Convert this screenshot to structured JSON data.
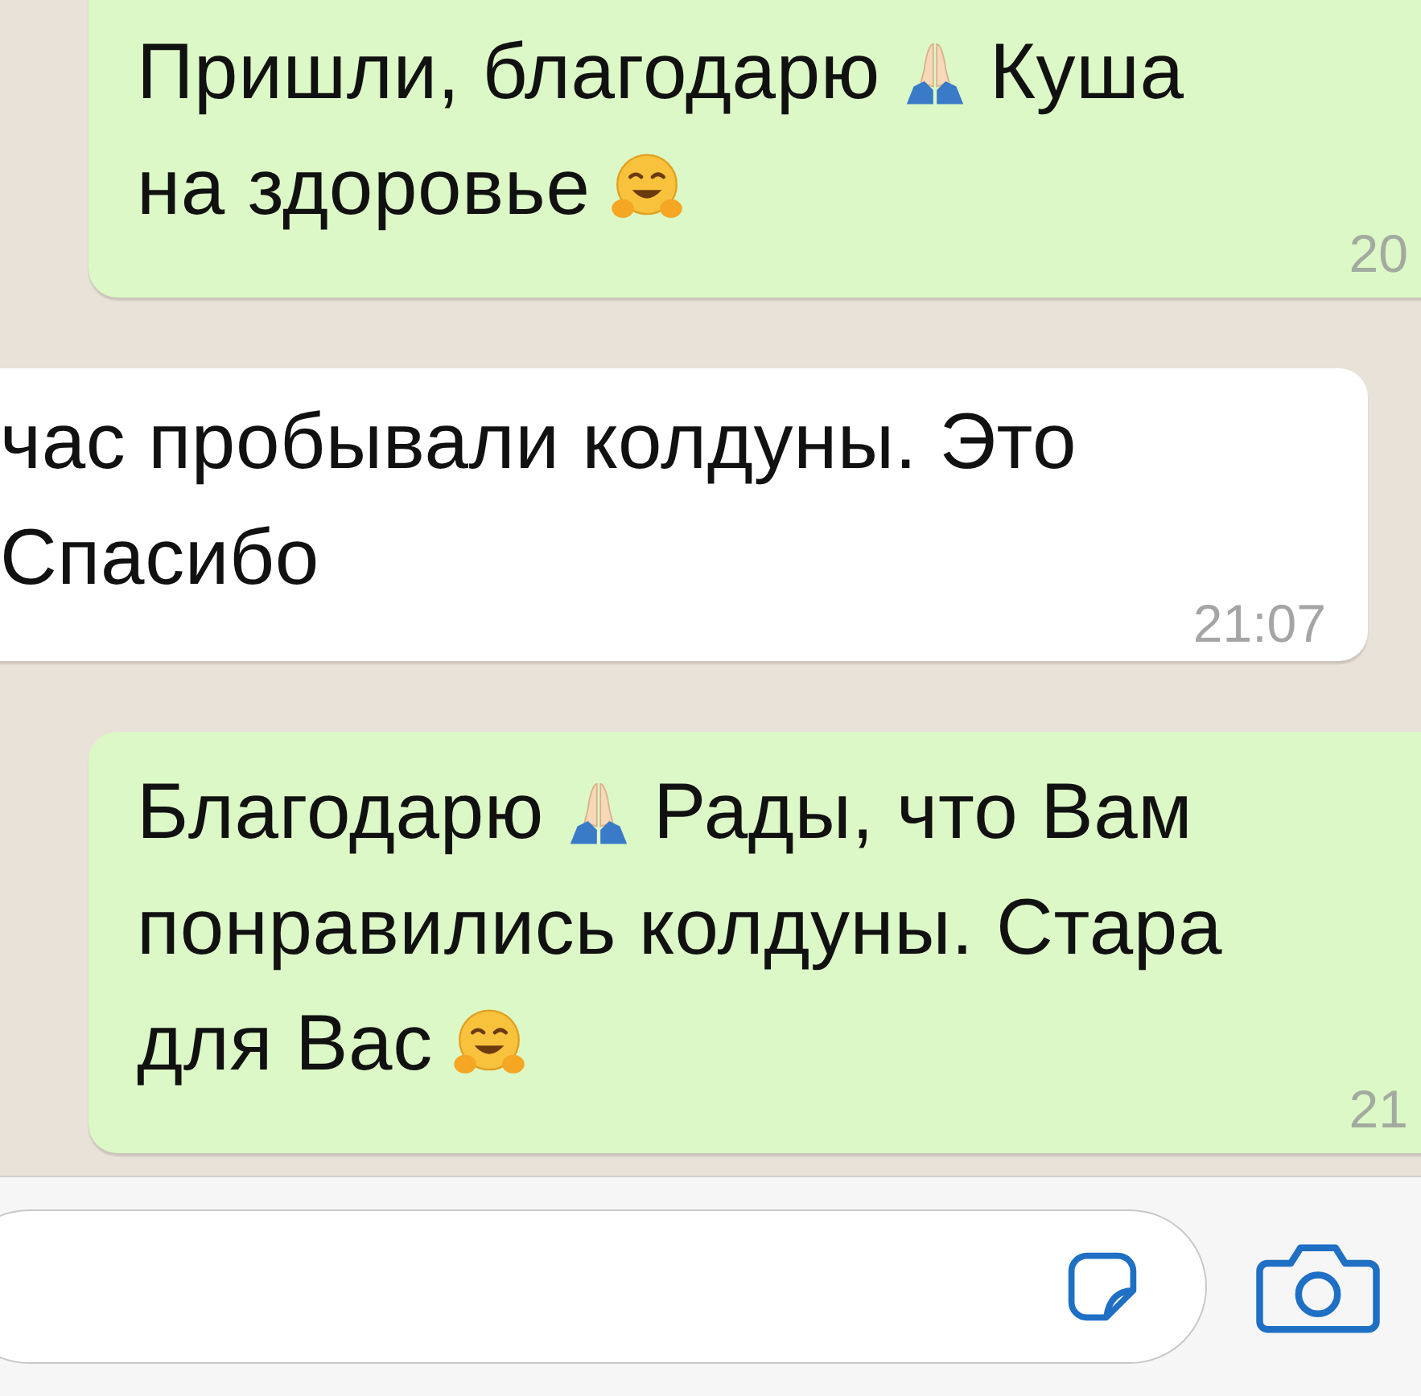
{
  "messages": [
    {
      "kind": "out",
      "lines": [
        [
          {
            "kind": "text",
            "text": "Пришли, благодарю"
          },
          {
            "kind": "pray"
          },
          {
            "kind": "text",
            "text": "Куша"
          }
        ],
        [
          {
            "kind": "text",
            "text": "на здоровье"
          },
          {
            "kind": "hug"
          }
        ]
      ],
      "time": "20"
    },
    {
      "kind": "in",
      "lines": [
        [
          {
            "kind": "text",
            "text": "час пробывали колдуны. Это"
          }
        ],
        [
          {
            "kind": "text",
            "text": "Спасибо"
          }
        ]
      ],
      "time": "21:07"
    },
    {
      "kind": "out",
      "lines": [
        [
          {
            "kind": "text",
            "text": "Благодарю"
          },
          {
            "kind": "pray"
          },
          {
            "kind": "text",
            "text": "Рады, что Вам"
          }
        ],
        [
          {
            "kind": "text",
            "text": "понравились колдуны. Стара"
          }
        ],
        [
          {
            "kind": "text",
            "text": "для Вас"
          },
          {
            "kind": "hug"
          }
        ]
      ],
      "time": "21"
    }
  ]
}
